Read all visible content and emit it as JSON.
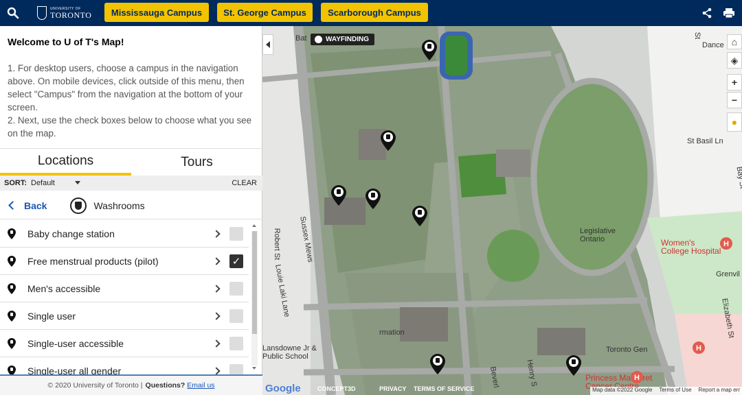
{
  "header": {
    "logo_small": "UNIVERSITY OF",
    "logo_big": "TORONTO",
    "campus_buttons": [
      "Mississauga Campus",
      "St. George Campus",
      "Scarborough Campus"
    ],
    "colors": {
      "bar": "#002a5c",
      "accent": "#f2c300"
    },
    "icons": [
      "search-icon",
      "share-icon",
      "print-icon"
    ]
  },
  "panel": {
    "welcome_title": "Welcome to U of T's Map!",
    "welcome_text": "1. For desktop users, choose a campus in the navigation above. On mobile devices, click outside of this menu, then select \"Campus\" from the navigation at the bottom of your screen.\n2. Next, use the check boxes below to choose what you see on the map.",
    "tabs": [
      "Locations",
      "Tours"
    ],
    "active_tab": "Locations",
    "sort": {
      "label": "SORT:",
      "value": "Default",
      "clear": "CLEAR"
    },
    "back_label": "Back",
    "category": "Washrooms",
    "items": [
      {
        "label": "Baby change station",
        "checked": false
      },
      {
        "label": "Free menstrual products (pilot)",
        "checked": true
      },
      {
        "label": "Men's accessible",
        "checked": false
      },
      {
        "label": "Single user",
        "checked": false
      },
      {
        "label": "Single-user accessible",
        "checked": false
      },
      {
        "label": "Single-user all gender",
        "checked": false
      }
    ],
    "footer": {
      "copyright": "© 2020 University of Toronto |",
      "questions": "Questions?",
      "email": "Email us"
    }
  },
  "map": {
    "wayfinding": "WAYFINDING",
    "labels": {
      "dance": "Dance",
      "st_basil": "St Basil Ln",
      "bay_st": "Bay St",
      "robert_st": "Robert St",
      "sussex": "Sussex Mews",
      "louie_laki": "Louie Laki Lane",
      "legislative": "Legislative\nOntario",
      "grenville": "Grenvil",
      "elizabeth": "Elizabeth St",
      "mation": "rmation",
      "lansdowne": "Lansdowne Jr &\nPublic School",
      "toronto_gen": "Toronto Gen",
      "beverley": "Beverl",
      "henry": "Henry S",
      "bat": "Bat",
      "st_top": "St"
    },
    "red_labels": {
      "womens": "Women's\nCollege Hospital",
      "margaret": "Princess Margaret\nCancer Centre"
    },
    "footer": {
      "google": "Google",
      "concept": "CONCEPT3D",
      "privacy": "PRIVACY",
      "terms": "TERMS OF SERVICE",
      "mapdata": "Map data ©2022 Google",
      "termsofuse": "Terms of Use",
      "report": "Report a map err"
    },
    "controls": [
      "home-icon",
      "layers-icon",
      "zoom-in-icon",
      "zoom-out-icon",
      "pegman-icon"
    ]
  }
}
